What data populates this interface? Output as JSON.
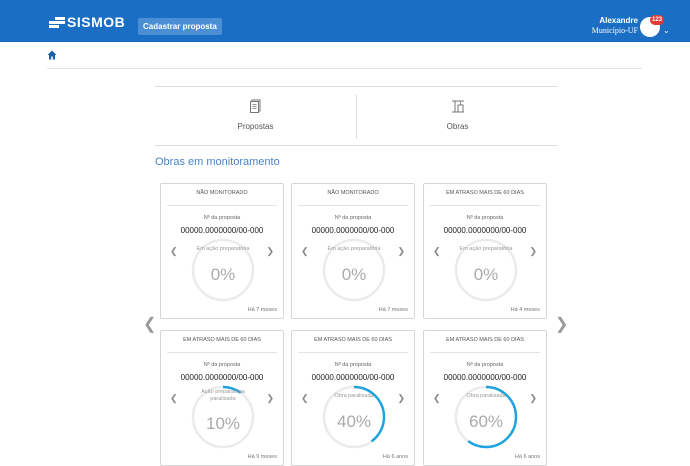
{
  "header": {
    "logo_text": "SISMOB",
    "cta_label": "Cadastrar proposta",
    "user_name": "Alexandre",
    "user_org": "Município-UF",
    "badge_count": "123",
    "brand_color": "#1a6fc4"
  },
  "tabs": [
    {
      "label": "Propostas",
      "icon": "document-icon"
    },
    {
      "label": "Obras",
      "icon": "construction-icon"
    }
  ],
  "section_title": "Obras em monitoramento",
  "cards": [
    {
      "status": "NÃO MONITORADO",
      "num_label": "Nº da proposta",
      "num": "00000.0000000/00-000",
      "phase": "Em ação preparatória",
      "percent": "0%",
      "progress": 0,
      "ago": "Há 7 meses"
    },
    {
      "status": "NÃO MONITORADO",
      "num_label": "Nº da proposta",
      "num": "00000.0000000/00-000",
      "phase": "Em ação preparatória",
      "percent": "0%",
      "progress": 0,
      "ago": "Há 7 meses"
    },
    {
      "status": "EM ATRASO MAIS DE 60 DIAS",
      "num_label": "Nº da proposta",
      "num": "00000.0000000/00-000",
      "phase": "Em ação preparatória",
      "percent": "0%",
      "progress": 0,
      "ago": "Há 4 meses"
    },
    {
      "status": "EM ATRASO MAIS DE 60 DIAS",
      "num_label": "Nº da proposta",
      "num": "00000.0000000/00-000",
      "phase": "Ação preparatória paralisada",
      "percent": "10%",
      "progress": 0.1,
      "ago": "Há 9 meses"
    },
    {
      "status": "EM ATRASO MAIS DE 60 DIAS",
      "num_label": "Nº da proposta",
      "num": "00000.0000000/00-000",
      "phase": "Obra paralisada",
      "percent": "40%",
      "progress": 0.4,
      "ago": "Há 6 anos"
    },
    {
      "status": "EM ATRASO MAIS DE 60 DIAS",
      "num_label": "Nº da proposta",
      "num": "00000.0000000/00-000",
      "phase": "Obra paralisada",
      "percent": "60%",
      "progress": 0.6,
      "ago": "Há 6 anos"
    }
  ],
  "progress_color": "#1fa3e0"
}
